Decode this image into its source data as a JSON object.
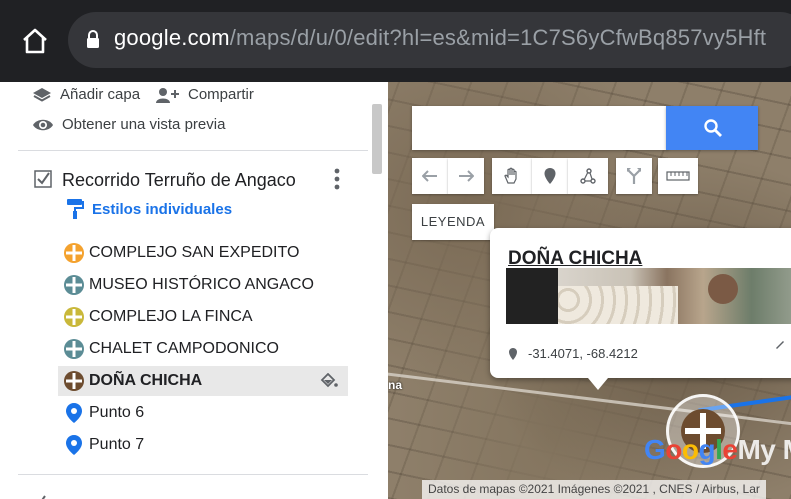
{
  "browser": {
    "url_host": "google.com",
    "url_path": "/maps/d/u/0/edit?hl=es&mid=1C7S6yCfwBq857vy5Hft"
  },
  "panel": {
    "add_layer_label": "Añadir capa",
    "share_label": "Compartir",
    "preview_label": "Obtener una vista previa",
    "layer": {
      "title": "Recorrido Terruño de Angaco",
      "checked": true,
      "styles_link": "Estilos individuales"
    },
    "features": [
      {
        "label": "COMPLEJO SAN EXPEDITO",
        "icon": "orange-circle-icon",
        "color": "#f4a22e"
      },
      {
        "label": "MUSEO HISTÓRICO ANGACO",
        "icon": "teal-circle-icon",
        "color": "#5b8c95"
      },
      {
        "label": "COMPLEJO LA FINCA",
        "icon": "olive-circle-icon",
        "color": "#c9b83a"
      },
      {
        "label": "CHALET CAMPODONICO",
        "icon": "teal-circle-icon",
        "color": "#5b8c95"
      },
      {
        "label": "DOÑA CHICHA",
        "icon": "brown-circle-icon",
        "color": "#6d4c2f",
        "selected": true
      },
      {
        "label": "Punto 6",
        "icon": "blue-pin-icon",
        "color": "#1a73e8"
      },
      {
        "label": "Punto 7",
        "icon": "blue-pin-icon",
        "color": "#1a73e8"
      }
    ]
  },
  "map": {
    "legend_label": "LEYENDA",
    "side_label": "na",
    "info": {
      "title": "DOÑA CHICHA",
      "coords": "-31.4071, -68.4212"
    },
    "watermark": {
      "g1": "G",
      "o1": "o",
      "o2": "o",
      "g2": "g",
      "l": "l",
      "e": "e",
      "rest": "My M"
    },
    "attribution": "Datos de mapas ©2021 Imágenes ©2021 , CNES / Airbus, Lar"
  },
  "colors": {
    "accent": "#4285f4",
    "link": "#1a73e8",
    "chrome": "#202124"
  }
}
